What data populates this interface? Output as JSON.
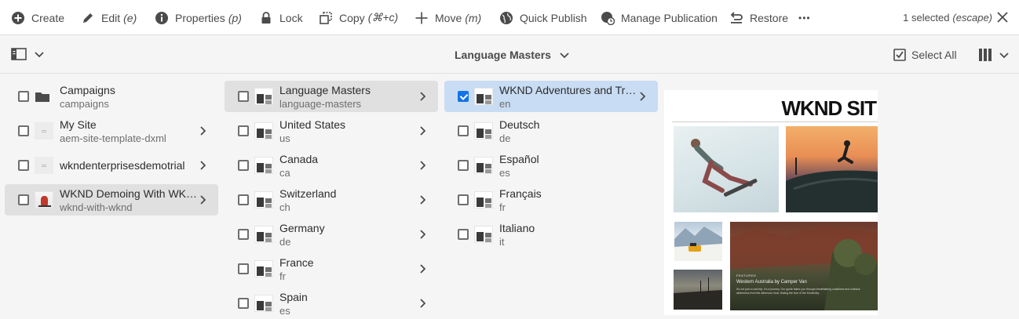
{
  "actionbar": {
    "create": "Create",
    "edit": "Edit",
    "edit_shortcut": "(e)",
    "properties": "Properties",
    "properties_shortcut": "(p)",
    "lock": "Lock",
    "copy": "Copy",
    "copy_shortcut": "(⌘+c)",
    "move": "Move",
    "move_shortcut": "(m)",
    "quick_publish": "Quick Publish",
    "manage_publication": "Manage Publication",
    "restore": "Restore",
    "more": "•••",
    "selection_count": "1 selected",
    "escape_hint": "(escape)"
  },
  "header": {
    "breadcrumb": "Language Masters",
    "select_all": "Select All"
  },
  "columns": [
    {
      "items": [
        {
          "title": "Campaigns",
          "name": "campaigns",
          "thumb": "folder",
          "has_children": false,
          "state": "none"
        },
        {
          "title": "My Site",
          "name": "aem-site-template-dxml",
          "thumb": "blank",
          "has_children": true,
          "state": "none"
        },
        {
          "title": "wkndenterprisesdemotrial",
          "name": "",
          "thumb": "blank",
          "has_children": true,
          "state": "none"
        },
        {
          "title": "WKND Demoing With WKND ...",
          "name": "wknd-with-wknd",
          "thumb": "skate",
          "has_children": true,
          "state": "active"
        }
      ]
    },
    {
      "items": [
        {
          "title": "Language Masters",
          "name": "language-masters",
          "has_children": true,
          "state": "active"
        },
        {
          "title": "United States",
          "name": "us",
          "has_children": true,
          "state": "none"
        },
        {
          "title": "Canada",
          "name": "ca",
          "has_children": true,
          "state": "none"
        },
        {
          "title": "Switzerland",
          "name": "ch",
          "has_children": true,
          "state": "none"
        },
        {
          "title": "Germany",
          "name": "de",
          "has_children": true,
          "state": "none"
        },
        {
          "title": "France",
          "name": "fr",
          "has_children": true,
          "state": "none"
        },
        {
          "title": "Spain",
          "name": "es",
          "has_children": true,
          "state": "none"
        }
      ]
    },
    {
      "items": [
        {
          "title": "WKND Adventures and Travel",
          "name": "en",
          "has_children": true,
          "state": "selected"
        },
        {
          "title": "Deutsch",
          "name": "de",
          "has_children": false,
          "state": "none"
        },
        {
          "title": "Español",
          "name": "es",
          "has_children": false,
          "state": "none"
        },
        {
          "title": "Français",
          "name": "fr",
          "has_children": false,
          "state": "none"
        },
        {
          "title": "Italiano",
          "name": "it",
          "has_children": false,
          "state": "none"
        }
      ]
    }
  ],
  "preview": {
    "site_title": "WKND SIT",
    "featured_label": "FEATURED",
    "featured_caption": "Western Australia by Camper Van",
    "featured_body": "It's not just a road trip, it's a journey. Our guide takes you through breathtaking coastlines and outback wilderness from the afternoon heat, finding the true of the Kimberley."
  },
  "colors": {
    "selected_row": "#c8dcf3",
    "active_row": "#e0e0e0",
    "checkbox_on": "#1473e6"
  }
}
